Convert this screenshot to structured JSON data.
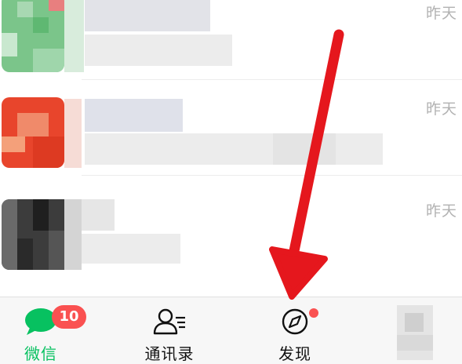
{
  "chats": [
    {
      "time": "昨天"
    },
    {
      "time": "昨天"
    },
    {
      "time": "昨天"
    }
  ],
  "tabbar": {
    "tabs": [
      {
        "label": "微信",
        "badge": "10",
        "active": true,
        "icon": "chat-bubble-icon"
      },
      {
        "label": "通讯录",
        "active": false,
        "icon": "contacts-icon"
      },
      {
        "label": "发现",
        "active": false,
        "icon": "compass-icon",
        "dot": true
      },
      {
        "label": "",
        "active": false,
        "icon": "me-icon"
      }
    ]
  },
  "colors": {
    "accent": "#07c160",
    "badge": "#fa5151",
    "annotation_arrow": "#e5171d"
  }
}
